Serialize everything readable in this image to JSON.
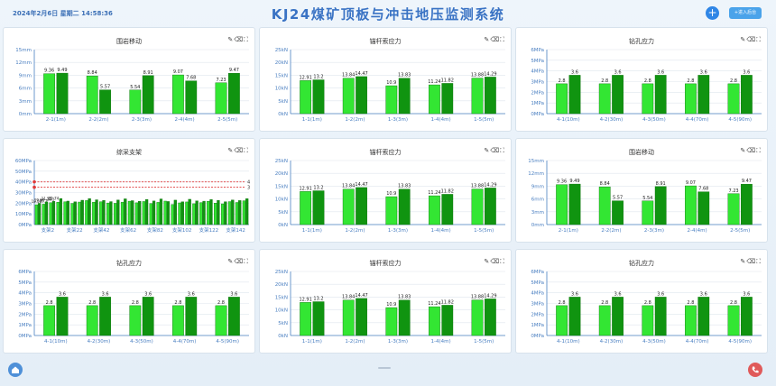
{
  "header": {
    "datetime": "2024年2月6日 星期二 14:58:36",
    "title": "KJ24煤矿顶板与冲击地压监测系统",
    "add_button": "+",
    "enter_button": "+进入后台"
  },
  "colors": {
    "bar_light": "#33e633",
    "bar_dark": "#109410",
    "axis": "#4a7fc1",
    "grid": "#dfe6ee",
    "alarm_line": "#e03b3b"
  },
  "panels": [
    {
      "title": "围岩移动",
      "chart_data": {
        "type": "bar",
        "categories": [
          "2-1(1m)",
          "2-2(2m)",
          "2-3(3m)",
          "2-4(4m)",
          "2-5(5m)"
        ],
        "series": [
          {
            "values": [
              9.36,
              8.84,
              5.54,
              9.07,
              7.23
            ]
          },
          {
            "values": [
              9.49,
              5.57,
              8.91,
              7.68,
              9.47
            ]
          }
        ],
        "yticks": [
          "0mm",
          "3mm",
          "6mm",
          "9mm",
          "12mm",
          "15mm"
        ],
        "ylim": [
          0,
          15
        ]
      }
    },
    {
      "title": "锚杆索应力",
      "chart_data": {
        "type": "bar",
        "categories": [
          "1-1(1m)",
          "1-2(2m)",
          "1-3(3m)",
          "1-4(4m)",
          "1-5(5m)"
        ],
        "series": [
          {
            "values": [
              12.91,
              13.84,
              10.9,
              11.24,
              13.88
            ]
          },
          {
            "values": [
              13.2,
              14.47,
              13.83,
              11.82,
              14.29
            ]
          }
        ],
        "yticks": [
          "0kN",
          "5kN",
          "10kN",
          "15kN",
          "20kN",
          "25kN"
        ],
        "ylim": [
          0,
          25
        ]
      }
    },
    {
      "title": "钻孔应力",
      "chart_data": {
        "type": "bar",
        "categories": [
          "4-1(10m)",
          "4-2(30m)",
          "4-3(50m)",
          "4-4(70m)",
          "4-5(90m)"
        ],
        "series": [
          {
            "values": [
              2.8,
              2.8,
              2.8,
              2.8,
              2.8
            ]
          },
          {
            "values": [
              3.6,
              3.6,
              3.6,
              3.6,
              3.6
            ]
          }
        ],
        "yticks": [
          "0MPa",
          "1MPa",
          "2MPa",
          "3MPa",
          "4MPa",
          "5MPa",
          "6MPa"
        ],
        "ylim": [
          0,
          6
        ]
      }
    },
    {
      "title": "综采支架",
      "chart_data": {
        "type": "bar",
        "categories": [
          "支架2",
          "支架22",
          "支架42",
          "支架62",
          "支架82",
          "支架102",
          "支架122",
          "支架142"
        ],
        "series": [
          {
            "values": [
              18.59,
              19.1,
              20.5,
              20.94,
              21.3,
              19.8,
              21.1,
              22.5,
              20.9,
              21.4,
              20.2,
              19.9,
              21.0,
              21.9,
              20.4,
              21.6,
              19.7,
              20.8,
              22.0,
              18.8,
              20.3,
              21.2,
              19.5,
              20.6,
              21.8,
              20.1,
              19.4,
              21.5,
              20.7,
              22.3
            ]
          },
          {
            "values": [
              19.87,
              21.25,
              21.74,
              24.4,
              22.0,
              21.3,
              22.8,
              24.3,
              23.2,
              22.6,
              21.5,
              23.0,
              24.1,
              22.4,
              21.8,
              23.5,
              22.1,
              24.0,
              21.6,
              22.9,
              21.3,
              23.7,
              22.2,
              21.9,
              23.4,
              22.7,
              21.4,
              23.0,
              22.5,
              24.2
            ]
          }
        ],
        "yticks": [
          "0MPa",
          "10MPa",
          "20MPa",
          "30MPa",
          "40MPa",
          "50MPa",
          "60MPa"
        ],
        "ylim": [
          0,
          60
        ],
        "alarm_lines": [
          {
            "value": 40,
            "label": "4"
          },
          {
            "value": 35,
            "label": "3"
          }
        ]
      }
    },
    {
      "title": "锚杆索应力",
      "chart_data": {
        "type": "bar",
        "categories": [
          "1-1(1m)",
          "1-2(2m)",
          "1-3(3m)",
          "1-4(4m)",
          "1-5(5m)"
        ],
        "series": [
          {
            "values": [
              12.91,
              13.84,
              10.9,
              11.24,
              13.88
            ]
          },
          {
            "values": [
              13.2,
              14.47,
              13.83,
              11.82,
              14.29
            ]
          }
        ],
        "yticks": [
          "0kN",
          "5kN",
          "10kN",
          "15kN",
          "20kN",
          "25kN"
        ],
        "ylim": [
          0,
          25
        ]
      }
    },
    {
      "title": "围岩移动",
      "chart_data": {
        "type": "bar",
        "categories": [
          "2-1(1m)",
          "2-2(2m)",
          "2-3(3m)",
          "2-4(4m)",
          "2-5(5m)"
        ],
        "series": [
          {
            "values": [
              9.36,
              8.84,
              5.54,
              9.07,
              7.23
            ]
          },
          {
            "values": [
              9.49,
              5.57,
              8.91,
              7.68,
              9.47
            ]
          }
        ],
        "yticks": [
          "0mm",
          "3mm",
          "6mm",
          "9mm",
          "12mm",
          "15mm"
        ],
        "ylim": [
          0,
          15
        ]
      }
    },
    {
      "title": "钻孔应力",
      "chart_data": {
        "type": "bar",
        "categories": [
          "4-1(10m)",
          "4-2(30m)",
          "4-3(50m)",
          "4-4(70m)",
          "4-5(90m)"
        ],
        "series": [
          {
            "values": [
              2.8,
              2.8,
              2.8,
              2.8,
              2.8
            ]
          },
          {
            "values": [
              3.6,
              3.6,
              3.6,
              3.6,
              3.6
            ]
          }
        ],
        "yticks": [
          "0MPa",
          "1MPa",
          "2MPa",
          "3MPa",
          "4MPa",
          "5MPa",
          "6MPa"
        ],
        "ylim": [
          0,
          6
        ]
      }
    },
    {
      "title": "锚杆索应力",
      "chart_data": {
        "type": "bar",
        "categories": [
          "1-1(1m)",
          "1-2(2m)",
          "1-3(3m)",
          "1-4(4m)",
          "1-5(5m)"
        ],
        "series": [
          {
            "values": [
              12.91,
              13.84,
              10.9,
              11.24,
              13.88
            ]
          },
          {
            "values": [
              13.2,
              14.47,
              13.83,
              11.82,
              14.29
            ]
          }
        ],
        "yticks": [
          "0kN",
          "5kN",
          "10kN",
          "15kN",
          "20kN",
          "25kN"
        ],
        "ylim": [
          0,
          25
        ]
      }
    },
    {
      "title": "钻孔应力",
      "chart_data": {
        "type": "bar",
        "categories": [
          "4-1(10m)",
          "4-2(30m)",
          "4-3(50m)",
          "4-4(70m)",
          "4-5(90m)"
        ],
        "series": [
          {
            "values": [
              2.8,
              2.8,
              2.8,
              2.8,
              2.8
            ]
          },
          {
            "values": [
              3.6,
              3.6,
              3.6,
              3.6,
              3.6
            ]
          }
        ],
        "yticks": [
          "0MPa",
          "1MPa",
          "2MPa",
          "3MPa",
          "4MPa",
          "5MPa",
          "6MPa"
        ],
        "ylim": [
          0,
          6
        ]
      }
    }
  ],
  "toolbar_icons": [
    "edit-icon",
    "delete-icon",
    "fullscreen-icon"
  ]
}
